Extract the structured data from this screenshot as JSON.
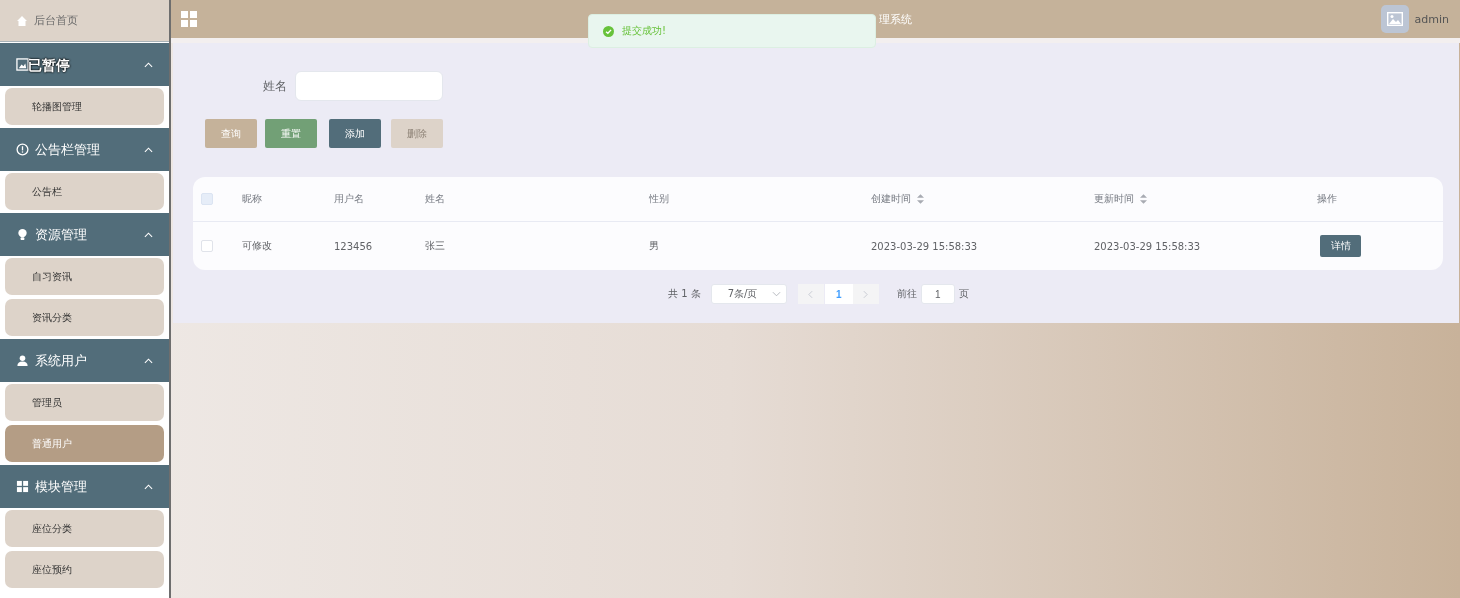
{
  "sidebar": {
    "home": {
      "label": "后台首页"
    },
    "groups": [
      {
        "expanded": true,
        "items": [
          {
            "label": "轮播图管理",
            "selected": false
          }
        ]
      },
      {
        "title": "公告栏管理",
        "expanded": true,
        "items": [
          {
            "label": "公告栏",
            "selected": false
          }
        ]
      },
      {
        "title": "资源管理",
        "expanded": true,
        "items": [
          {
            "label": "自习资讯",
            "selected": false
          },
          {
            "label": "资讯分类",
            "selected": false
          }
        ]
      },
      {
        "title": "系统用户",
        "expanded": true,
        "items": [
          {
            "label": "管理员",
            "selected": false
          },
          {
            "label": "普通用户",
            "selected": true
          }
        ]
      },
      {
        "title": "模块管理",
        "expanded": true,
        "items": [
          {
            "label": "座位分类",
            "selected": false
          },
          {
            "label": "座位预约",
            "selected": false
          }
        ]
      }
    ],
    "paused_overlay": "已暂停"
  },
  "header": {
    "title": "理系统",
    "user": "admin"
  },
  "toast": {
    "message": "提交成功!"
  },
  "search": {
    "label": "姓名"
  },
  "buttons": [
    {
      "label": "查询",
      "kind": "query",
      "disabled": false
    },
    {
      "label": "重置",
      "kind": "reset",
      "disabled": false
    },
    {
      "label": "添加",
      "kind": "add",
      "disabled": false
    },
    {
      "label": "删除",
      "kind": "delete",
      "disabled": true
    }
  ],
  "table": {
    "columns": [
      {
        "label": "昵称",
        "sortable": false
      },
      {
        "label": "用户名",
        "sortable": false
      },
      {
        "label": "姓名",
        "sortable": false
      },
      {
        "label": "性别",
        "sortable": false
      },
      {
        "label": "创建时间",
        "sortable": true
      },
      {
        "label": "更新时间",
        "sortable": true
      },
      {
        "label": "操作",
        "sortable": false
      }
    ],
    "header_checked": false,
    "rows": [
      {
        "checked": false,
        "cells": [
          "可修改",
          "123456",
          "张三",
          "男",
          "2023-03-29 15:58:33",
          "2023-03-29 15:58:33"
        ],
        "action": "详情"
      }
    ]
  },
  "pagination": {
    "total": "共 1 条",
    "page_size": "7条/页",
    "pages": [
      {
        "label": "1",
        "selected": true
      }
    ],
    "goto_label": "前往",
    "goto_value": "1",
    "page_suffix": "页"
  }
}
